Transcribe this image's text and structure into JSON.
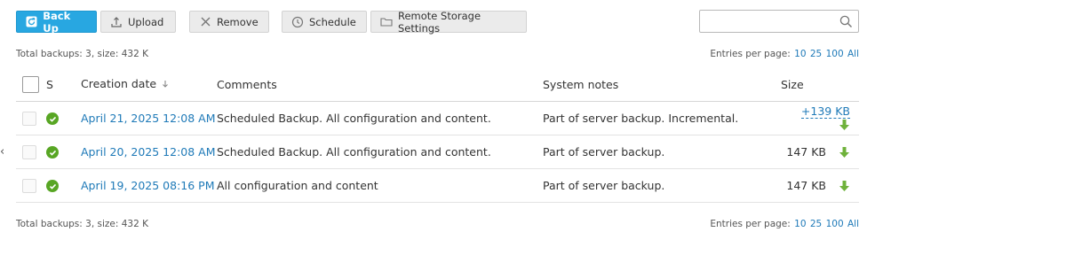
{
  "toolbar": {
    "backup_label": "Back Up",
    "upload_label": "Upload",
    "remove_label": "Remove",
    "schedule_label": "Schedule",
    "remote_label": "Remote Storage Settings"
  },
  "search": {
    "placeholder": "",
    "value": ""
  },
  "summary_top": "Total backups: 3, size: 432 K",
  "summary_bottom": "Total backups: 3, size: 432 K",
  "entries_per_page": {
    "label": "Entries per page:",
    "options": [
      "10",
      "25",
      "100",
      "All"
    ]
  },
  "table": {
    "headers": {
      "status": "S",
      "date": "Creation date",
      "comments": "Comments",
      "system": "System notes",
      "size": "Size"
    },
    "rows": [
      {
        "date": "April 21, 2025 12:08 AM",
        "comments": "Scheduled Backup. All configuration and content.",
        "system": "Part of server backup. Incremental.",
        "size": "+139 KB"
      },
      {
        "date": "April 20, 2025 12:08 AM",
        "comments": "Scheduled Backup. All configuration and content.",
        "system": "Part of server backup.",
        "size": "147 KB"
      },
      {
        "date": "April 19, 2025 08:16 PM",
        "comments": "All configuration and content",
        "system": "Part of server backup.",
        "size": "147 KB"
      }
    ]
  },
  "icons": {
    "backup": "backup-icon",
    "upload": "upload-icon",
    "remove": "remove-icon",
    "schedule": "clock-icon",
    "remote": "folder-icon",
    "search": "search-icon",
    "status": "check-circle-icon",
    "download": "download-arrow-icon",
    "sort": "sort-down-icon",
    "collapse": "chevron-left-icon"
  },
  "colors": {
    "primary": "#28a7e1",
    "link": "#1f7ab8",
    "ok": "#58a624",
    "download": "#6fb23b"
  }
}
